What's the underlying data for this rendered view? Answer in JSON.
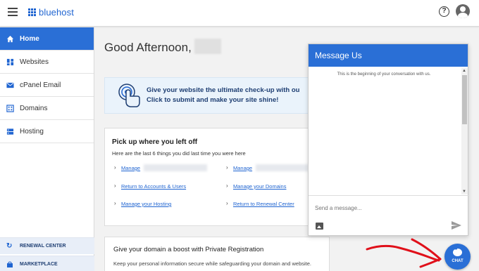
{
  "header": {
    "logo_text": "bluehost",
    "brand_color": "#2065d1",
    "help_icon": "question-circle-icon",
    "avatar_icon": "user-avatar-icon",
    "menu_icon": "hamburger-menu-icon"
  },
  "sidebar": {
    "items": [
      {
        "label": "Home",
        "icon": "home-icon",
        "active": true
      },
      {
        "label": "Websites",
        "icon": "websites-grid-icon"
      },
      {
        "label": "cPanel Email",
        "icon": "email-icon"
      },
      {
        "label": "Domains",
        "icon": "domains-icon"
      },
      {
        "label": "Hosting",
        "icon": "hosting-icon"
      }
    ],
    "bottom": [
      {
        "label": "RENEWAL CENTER",
        "icon": "renewal-icon"
      },
      {
        "label": "MARKETPLACE",
        "icon": "marketplace-icon"
      }
    ]
  },
  "main": {
    "greeting": "Good Afternoon,",
    "promo": {
      "line1": "Give your website the ultimate check-up with ou",
      "line2": "Click to submit and make your site shine!"
    },
    "recent": {
      "title": "Pick up where you left off",
      "subtitle": "Here are the last 6 things you did last time you were here",
      "links": [
        "Manage",
        "Manage",
        "Return to Accounts & Users",
        "Manage your Domains",
        "Manage your Hosting",
        "Return to Renewal Center"
      ]
    },
    "domain_card": {
      "title": "Give your domain a boost with Private Registration",
      "subtitle": "Keep your personal information secure while safeguarding your domain and website."
    }
  },
  "chat": {
    "title": "Message Us",
    "begin_text": "This is the beginning of your conversation with us.",
    "input_placeholder": "Send a message...",
    "button_label": "CHAT",
    "accent": "#2a6fd6",
    "annotation_color": "#e0101a"
  }
}
